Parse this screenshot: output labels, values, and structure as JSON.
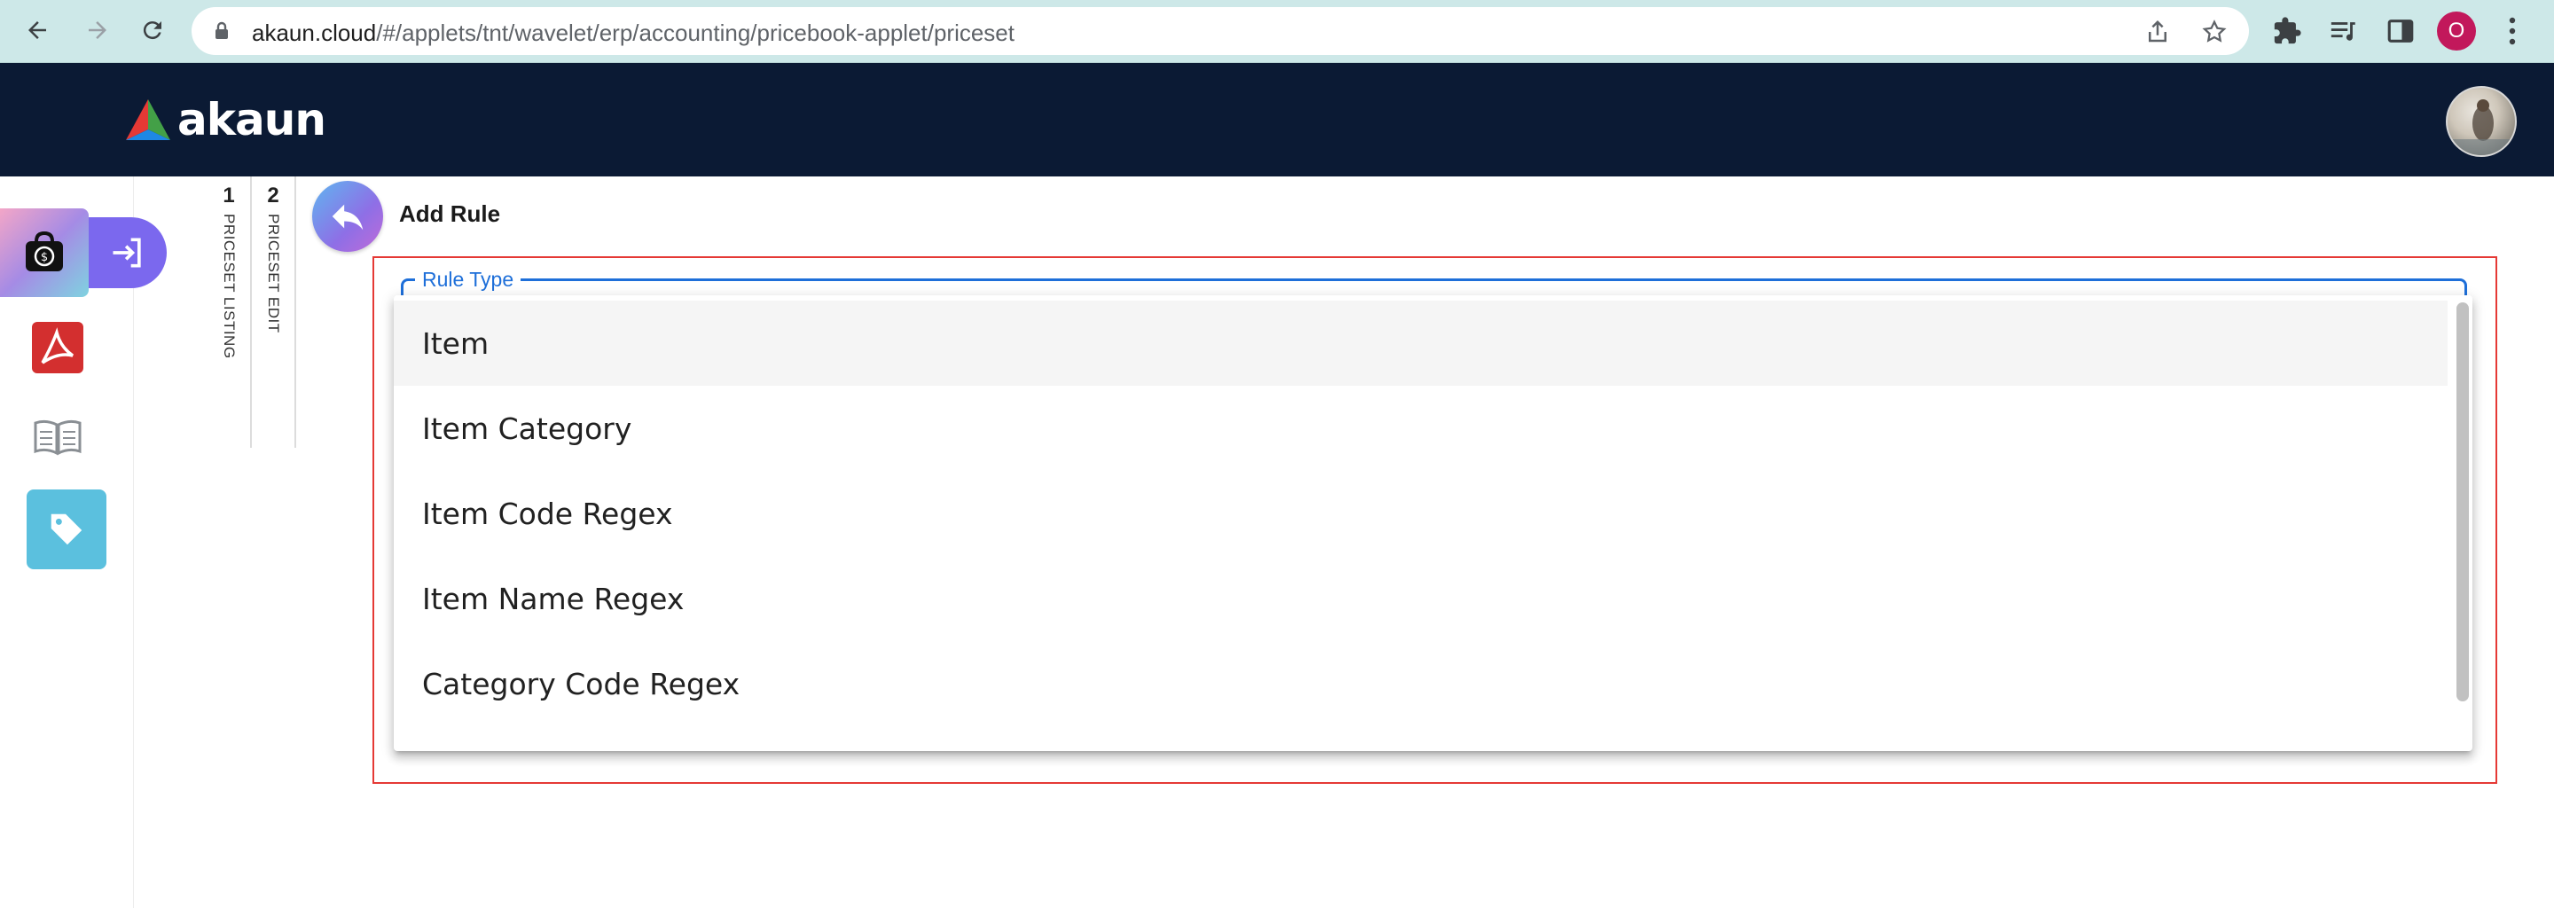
{
  "browser": {
    "url_host": "akaun.cloud",
    "url_path": "/#/applets/tnt/wavelet/erp/accounting/pricebook-applet/priceset",
    "profile_initial": "O"
  },
  "app": {
    "logo_text": "akaun"
  },
  "tabs": [
    {
      "num": "1",
      "label": "PRICESET LISTING"
    },
    {
      "num": "2",
      "label": "PRICESET EDIT"
    }
  ],
  "page": {
    "title": "Add Rule"
  },
  "rule_type": {
    "label": "Rule Type",
    "options": [
      "Item",
      "Item Category",
      "Item Code Regex",
      "Item Name Regex",
      "Category Code Regex"
    ],
    "highlighted": "Item"
  },
  "colors": {
    "header_bg": "#0b1a34",
    "accent_blue": "#1e6fd9",
    "error_red": "#e53935",
    "pill_purple": "#7b68ee",
    "tag_tile": "#5bc0de"
  }
}
